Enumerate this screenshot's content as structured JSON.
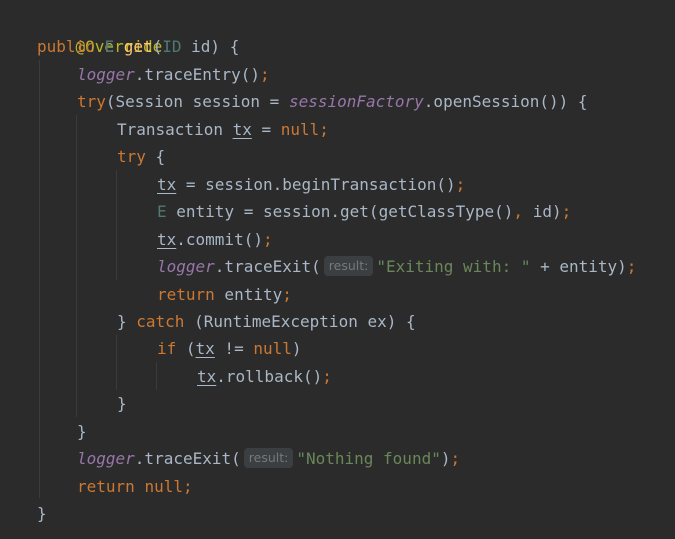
{
  "code": {
    "l1": {
      "annotation": "@Override"
    },
    "l2": {
      "public": "public",
      "type_e": "E",
      "method": "get",
      "open_paren": "(",
      "type_id": "ID",
      "rest": " id) {"
    },
    "l3": {
      "field": "logger",
      "call": ".traceEntry()",
      "semi": ";"
    },
    "l4": {
      "try": "try",
      "p1": "(Session session = ",
      "field": "sessionFactory",
      "p2": ".openSession()) {"
    },
    "l5": {
      "p1": "Transaction ",
      "var": "tx",
      "p2": " = ",
      "null": "null",
      "semi": ";"
    },
    "l6": {
      "try": "try",
      "rest": " {"
    },
    "l7": {
      "var": "tx",
      "rest": " = session.beginTransaction()",
      "semi": ";"
    },
    "l8": {
      "type_e": "E",
      "p1": " entity = session.get(getClassType()",
      "comma": ",",
      "p2": " id)",
      "semi": ";"
    },
    "l9": {
      "var": "tx",
      "rest": ".commit()",
      "semi": ";"
    },
    "l10": {
      "field": "logger",
      "call": ".traceExit(",
      "hint": "result:",
      "str": "\"Exiting with: \"",
      "rest": " + entity)",
      "semi": ";"
    },
    "l11": {
      "return": "return",
      "rest": " entity",
      "semi": ";"
    },
    "l12": {
      "brace": "} ",
      "catch": "catch",
      "rest": " (RuntimeException ex) {"
    },
    "l13": {
      "if": "if",
      "p1": " (",
      "var": "tx",
      "p2": " != ",
      "null": "null",
      "p3": ")"
    },
    "l14": {
      "var": "tx",
      "rest": ".rollback()",
      "semi": ";"
    },
    "l15": {
      "brace": "}"
    },
    "l16": {
      "brace": "}"
    },
    "l17": {
      "field": "logger",
      "call": ".traceExit(",
      "hint": "result:",
      "str": "\"Nothing found\"",
      "rest": ")",
      "semi": ";"
    },
    "l18": {
      "return": "return",
      "sp": " ",
      "null": "null",
      "semi": ";"
    },
    "l19": {
      "brace": "}"
    }
  },
  "colors": {
    "background": "#2b2b2b",
    "keyword": "#cc7832",
    "annotation": "#bbb529",
    "method": "#ffc66d",
    "type_param": "#507874",
    "field": "#9876aa",
    "string": "#6a8759",
    "text": "#a9b7c6",
    "hint_bg": "#3b3f41"
  }
}
